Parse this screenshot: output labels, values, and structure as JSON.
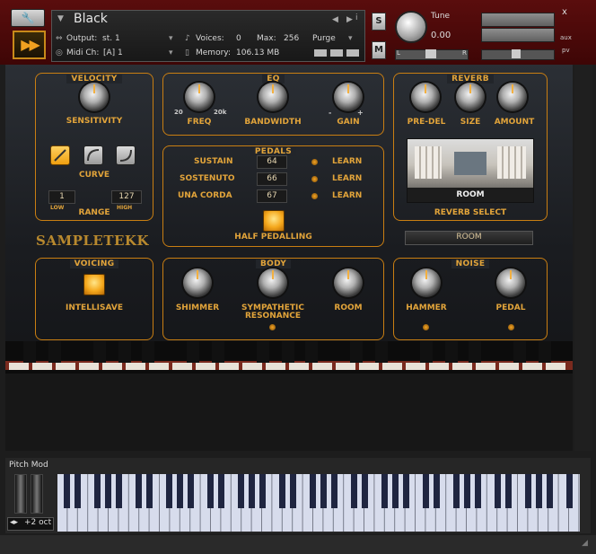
{
  "header": {
    "instrument_name": "Black",
    "output_label": "Output:",
    "output_value": "st. 1",
    "voices_label": "Voices:",
    "voices_value": "0",
    "max_label": "Max:",
    "max_value": "256",
    "purge_label": "Purge",
    "midi_label": "Midi Ch:",
    "midi_value": "[A]  1",
    "memory_label": "Memory:",
    "memory_value": "106.13 MB",
    "s_label": "S",
    "m_label": "M",
    "tune_label": "Tune",
    "tune_value": "0.00",
    "pan_left": "L",
    "pan_right": "R",
    "close_label": "x",
    "aux_label": "aux",
    "pv_label": "pv"
  },
  "velocity": {
    "title": "VELOCITY",
    "sensitivity_label": "SENSITIVITY",
    "curve_label": "CURVE",
    "range_low": "1",
    "range_high": "127",
    "low_label": "LOW",
    "high_label": "HIGH",
    "range_label": "RANGE"
  },
  "eq": {
    "title": "EQ",
    "freq_label": "FREQ",
    "freq_min": "20",
    "freq_max": "20k",
    "bandwidth_label": "BANDWIDTH",
    "gain_label": "GAIN",
    "gain_min": "-",
    "gain_max": "+"
  },
  "reverb": {
    "title": "REVERB",
    "predel_label": "PRE-DEL",
    "size_label": "SIZE",
    "amount_label": "AMOUNT",
    "room_caption": "ROOM",
    "select_label": "REVERB SELECT",
    "dropdown_value": "ROOM"
  },
  "pedals": {
    "title": "PEDALS",
    "rows": [
      {
        "name": "SUSTAIN",
        "value": "64",
        "learn": "LEARN"
      },
      {
        "name": "SOSTENUTO",
        "value": "66",
        "learn": "LEARN"
      },
      {
        "name": "UNA CORDA",
        "value": "67",
        "learn": "LEARN"
      }
    ],
    "half_label": "HALF PEDALLING"
  },
  "brand": {
    "logo": "SAMPLETEKK"
  },
  "voicing": {
    "title": "VOICING",
    "intellisave_label": "INTELLISAVE"
  },
  "body_section": {
    "title": "BODY",
    "shimmer_label": "SHIMMER",
    "sympathetic_label_1": "SYMPATHETIC",
    "sympathetic_label_2": "RESONANCE",
    "room_label": "ROOM"
  },
  "noise": {
    "title": "NOISE",
    "hammer_label": "HAMMER",
    "pedal_label": "PEDAL"
  },
  "keyboard": {
    "pitch_mod_label": "Pitch Mod",
    "octave_label": "+2 oct"
  },
  "colors": {
    "accent": "#e2a43a",
    "header_bg": "#4a0a0a"
  }
}
